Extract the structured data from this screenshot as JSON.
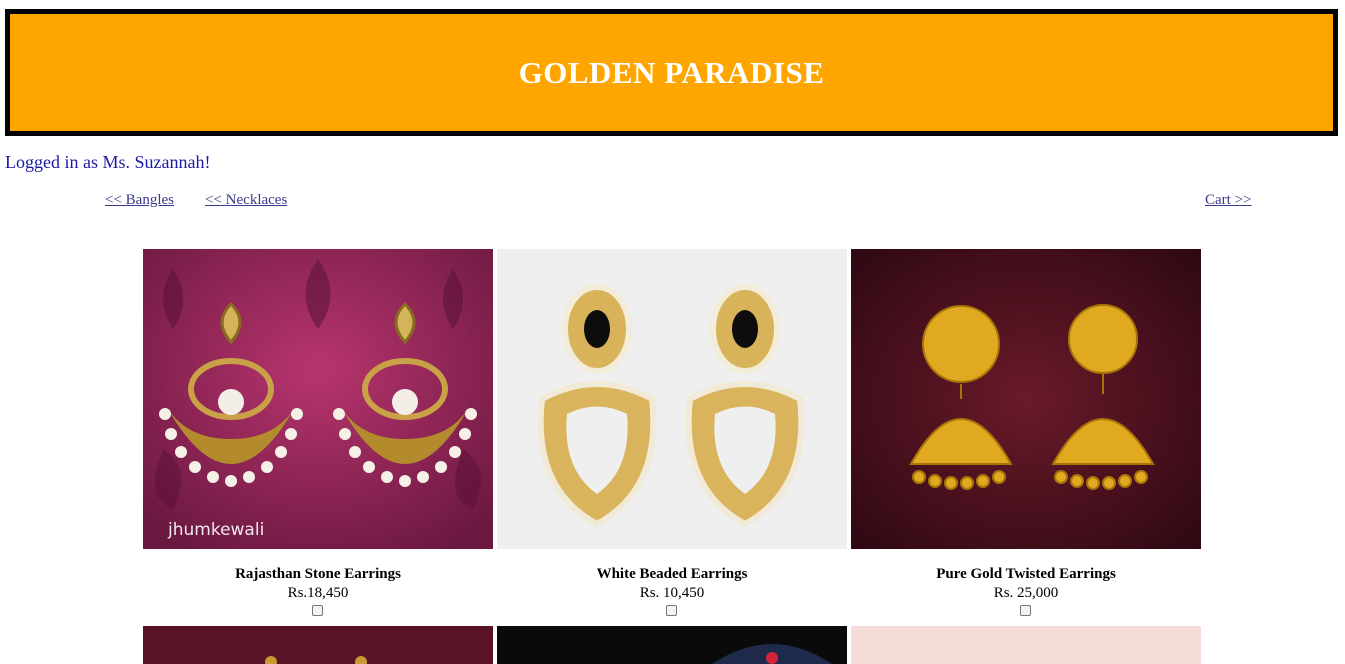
{
  "header": {
    "title": "GOLDEN PARADISE",
    "bg_color": "#ffa500",
    "border_color": "#000000"
  },
  "user": {
    "login_text": "Logged in as Ms. Suzannah!"
  },
  "nav": {
    "bangles": "<< Bangles",
    "necklaces": "<< Necklaces",
    "cart": "Cart >>"
  },
  "products": [
    {
      "name": "Rajasthan Stone Earrings",
      "price": "Rs.18,450",
      "watermark": "jhumkewali",
      "selected": false
    },
    {
      "name": "White Beaded Earrings",
      "price": "Rs. 10,450",
      "selected": false
    },
    {
      "name": "Pure Gold Twisted Earrings",
      "price": "Rs. 25,000",
      "selected": false
    }
  ]
}
